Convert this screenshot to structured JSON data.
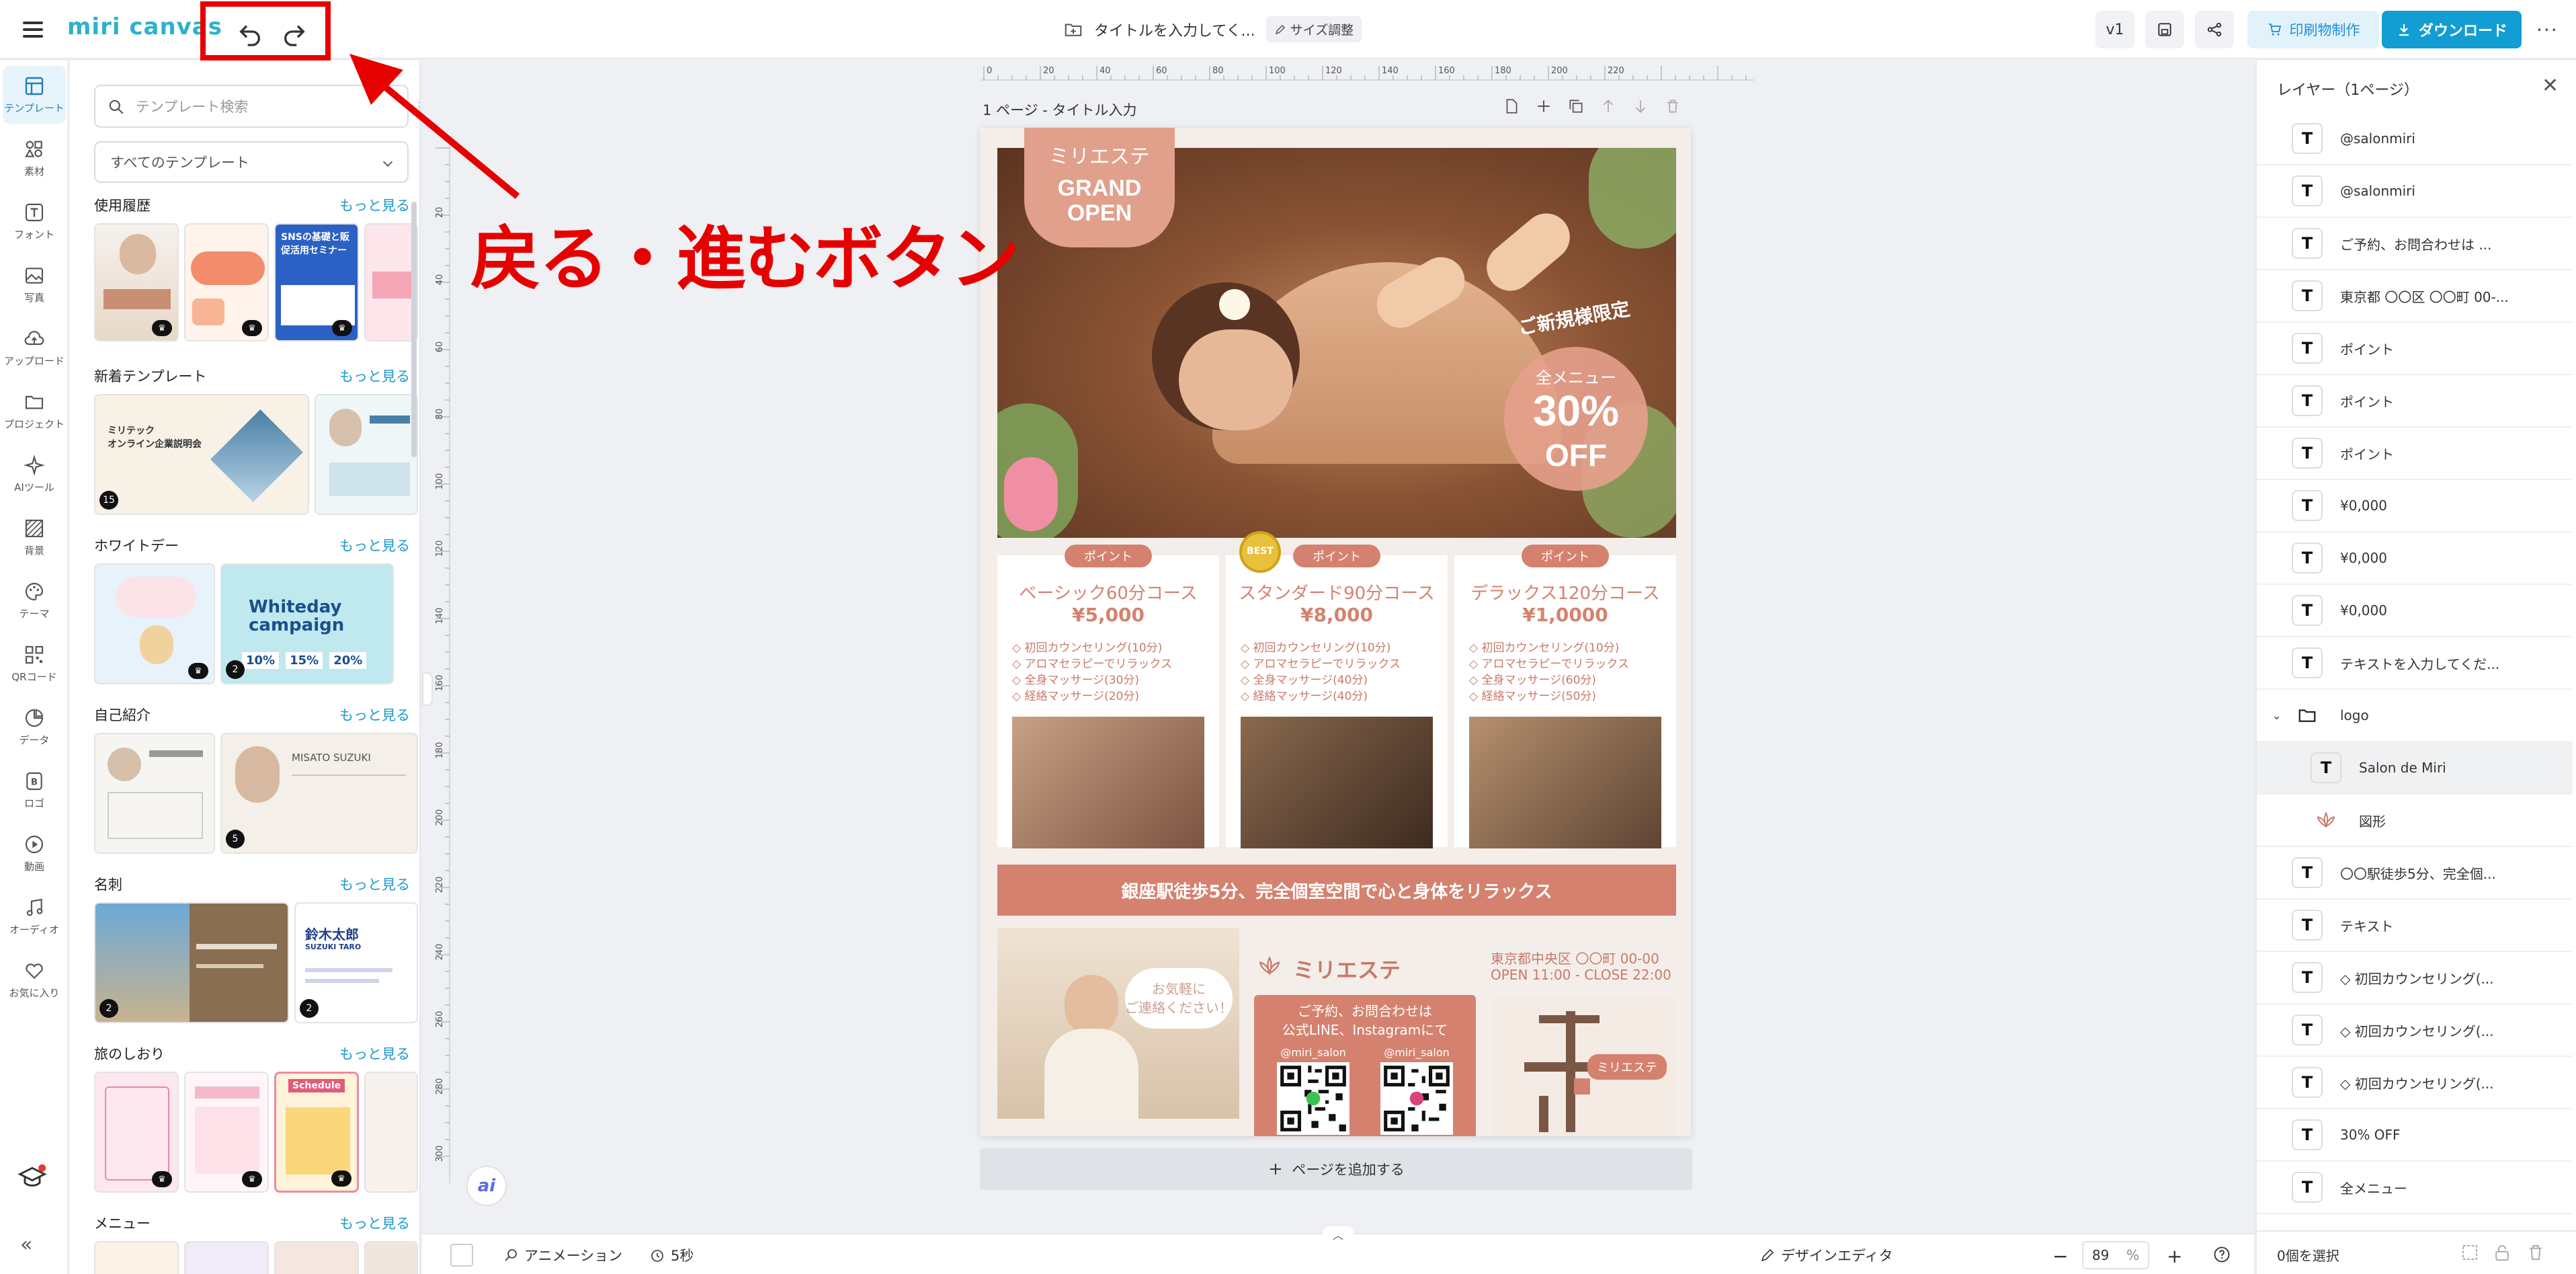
{
  "brand": {
    "name": "miri canvas"
  },
  "header": {
    "doc_title": "タイトルを入力してく...",
    "resize_label": "サイズ調整",
    "version": "v1",
    "print_label": "印刷物制作",
    "download_label": "ダウンロード"
  },
  "icon_rail": [
    {
      "label": "テンプレート",
      "icon": "template-icon"
    },
    {
      "label": "素材",
      "icon": "elements-icon"
    },
    {
      "label": "フォント",
      "icon": "font-icon"
    },
    {
      "label": "写真",
      "icon": "photo-icon"
    },
    {
      "label": "アップロード",
      "icon": "upload-icon"
    },
    {
      "label": "プロジェクト",
      "icon": "folder-icon"
    },
    {
      "label": "AIツール",
      "icon": "ai-sparkle-icon"
    },
    {
      "label": "背景",
      "icon": "background-icon"
    },
    {
      "label": "テーマ",
      "icon": "palette-icon"
    },
    {
      "label": "QRコード",
      "icon": "qr-icon"
    },
    {
      "label": "データ",
      "icon": "chart-icon"
    },
    {
      "label": "ロゴ",
      "icon": "logo-icon"
    },
    {
      "label": "動画",
      "icon": "video-icon"
    },
    {
      "label": "オーディオ",
      "icon": "audio-icon"
    },
    {
      "label": "お気に入り",
      "icon": "heart-icon"
    }
  ],
  "template_panel": {
    "search_placeholder": "テンプレート検索",
    "category_select": "すべてのテンプレート",
    "more_label": "もっと見る",
    "sections": [
      {
        "title": "使用履歴"
      },
      {
        "title": "新着テンプレート"
      },
      {
        "title": "ホワイトデー"
      },
      {
        "title": "自己紹介"
      },
      {
        "title": "名刺"
      },
      {
        "title": "旅のしおり"
      },
      {
        "title": "メニュー"
      }
    ],
    "thumb_texts": {
      "sns_seminar": "SNSの基礎と販促活用セミナー",
      "mirrortech": "ミリテック\nオンライン企業説明会",
      "whiteday": "Whiteday campaign",
      "whiteday_nums": [
        "10%",
        "15%",
        "20%"
      ],
      "suzuki": "MISATO SUZUKI",
      "namecard_name": "鈴木太郎",
      "namecard_en": "SUZUKI TARO",
      "schedule": "Schedule"
    },
    "badges": [
      "15",
      "2",
      "5",
      "2",
      "2"
    ]
  },
  "canvas": {
    "page_label": "1 ページ - タイトル入力",
    "add_page_label": "ページを追加する",
    "ruler_top": [
      "0",
      "20",
      "40",
      "60",
      "80",
      "100",
      "120",
      "140",
      "160",
      "180",
      "200",
      "220"
    ],
    "ruler_left": [
      "20",
      "40",
      "60",
      "80",
      "100",
      "120",
      "140",
      "160",
      "180",
      "200",
      "220",
      "240",
      "260",
      "280",
      "300"
    ]
  },
  "flyer": {
    "shop_name": "ミリエステ",
    "grand_open": "GRAND\nOPEN",
    "new_customer": "ご新規様限定",
    "all_menu": "全メニュー",
    "discount": "30%",
    "off": "OFF",
    "point_label": "ポイント",
    "best": "BEST",
    "courses": [
      {
        "name": "ベーシック60分コース",
        "price": "¥5,000",
        "items": [
          "◇ 初回カウンセリング(10分)",
          "◇ アロマセラピーでリラックス",
          "◇ 全身マッサージ(30分)",
          "◇ 経絡マッサージ(20分)"
        ]
      },
      {
        "name": "スタンダード90分コース",
        "price": "¥8,000",
        "items": [
          "◇ 初回カウンセリング(10分)",
          "◇ アロマセラピーでリラックス",
          "◇ 全身マッサージ(40分)",
          "◇ 経絡マッサージ(40分)"
        ]
      },
      {
        "name": "デラックス120分コース",
        "price": "¥1,0000",
        "items": [
          "◇ 初回カウンセリング(10分)",
          "◇ アロマセラピーでリラックス",
          "◇ 全身マッサージ(60分)",
          "◇ 経絡マッサージ(50分)"
        ]
      }
    ],
    "banner": "銀座駅徒歩5分、完全個室空間で心と身体をリラックス",
    "speech": "お気軽に\nご連絡ください！",
    "address": "東京都中央区 〇〇町 00-00",
    "hours": "OPEN 11:00 - CLOSE 22:00",
    "contact": "ご予約、お問合わせは\n公式LINE、Instagramにて",
    "handle": "@miri_salon",
    "map_label": "ミリエステ"
  },
  "layers": {
    "title": "レイヤー（1ページ）",
    "rows": [
      {
        "label": "@salonmiri",
        "type": "T"
      },
      {
        "label": "@salonmiri",
        "type": "T"
      },
      {
        "label": "ご予約、お問合わせは ...",
        "type": "T"
      },
      {
        "label": "東京都 〇〇区 〇〇町 00-...",
        "type": "T"
      },
      {
        "label": "ポイント",
        "type": "T"
      },
      {
        "label": "ポイント",
        "type": "T"
      },
      {
        "label": "ポイント",
        "type": "T"
      },
      {
        "label": "¥0,000",
        "type": "T"
      },
      {
        "label": "¥0,000",
        "type": "T"
      },
      {
        "label": "¥0,000",
        "type": "T"
      },
      {
        "label": "テキストを入力してくだ...",
        "type": "T"
      },
      {
        "label": "logo",
        "type": "folder"
      },
      {
        "label": "Salon de Miri",
        "type": "T"
      },
      {
        "label": "図形",
        "type": "shape"
      },
      {
        "label": "〇〇駅徒歩5分、完全個...",
        "type": "T"
      },
      {
        "label": "テキスト",
        "type": "T"
      },
      {
        "label": "◇ 初回カウンセリング(...",
        "type": "T"
      },
      {
        "label": "◇ 初回カウンセリング(...",
        "type": "T"
      },
      {
        "label": "◇ 初回カウンセリング(...",
        "type": "T"
      },
      {
        "label": "30% OFF",
        "type": "T"
      },
      {
        "label": "全メニュー",
        "type": "T"
      }
    ],
    "selected_count": "0個を選択"
  },
  "bottom": {
    "animation": "アニメーション",
    "duration": "5秒",
    "design_editor": "デザインエディタ",
    "zoom": "89",
    "zoom_unit": "%"
  },
  "annotation": {
    "text": "戻る・進むボタン",
    "color": "#e60000"
  },
  "colors": {
    "accent": "#129ed3",
    "brand": "#2bb3c9",
    "salmon": "#d4826f",
    "annotation": "#e60000"
  }
}
